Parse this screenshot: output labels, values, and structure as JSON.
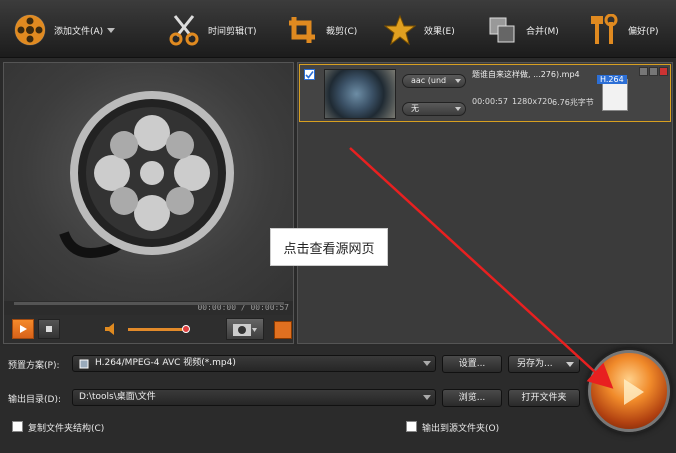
{
  "toolbar": {
    "add_file": "添加文件(A)",
    "clip": "时间剪辑(T)",
    "crop": "裁剪(C)",
    "effects": "效果(E)",
    "merge": "合并(M)",
    "prefs": "偏好(P)"
  },
  "player": {
    "time": "00:00:00 / 00:00:57",
    "volume_level": 0.9
  },
  "file": {
    "name": "题谁自来这样做, ...276).mp4",
    "audio": "aac (und",
    "subtitle": "无",
    "duration": "00:00:57",
    "resolution": "1280x720",
    "size": "6.76兆字节",
    "codec_badge": "H.264"
  },
  "overlay": {
    "tooltip": "点击查看源网页"
  },
  "bottom": {
    "preset_label": "预置方案(P):",
    "preset_value": "H.264/MPEG-4 AVC 视频(*.mp4)",
    "settings_btn": "设置...",
    "save_as_btn": "另存为...",
    "output_label": "输出目录(D):",
    "output_value": "D:\\tools\\桌面\\文件",
    "browse_btn": "浏览...",
    "open_folder_btn": "打开文件夹",
    "copy_structure": "复制文件夹结构(C)",
    "output_to_source": "输出到源文件夹(O)"
  },
  "colors": {
    "accent": "#e07020",
    "arrow": "#e82020",
    "highlight_border": "#d8a020"
  }
}
